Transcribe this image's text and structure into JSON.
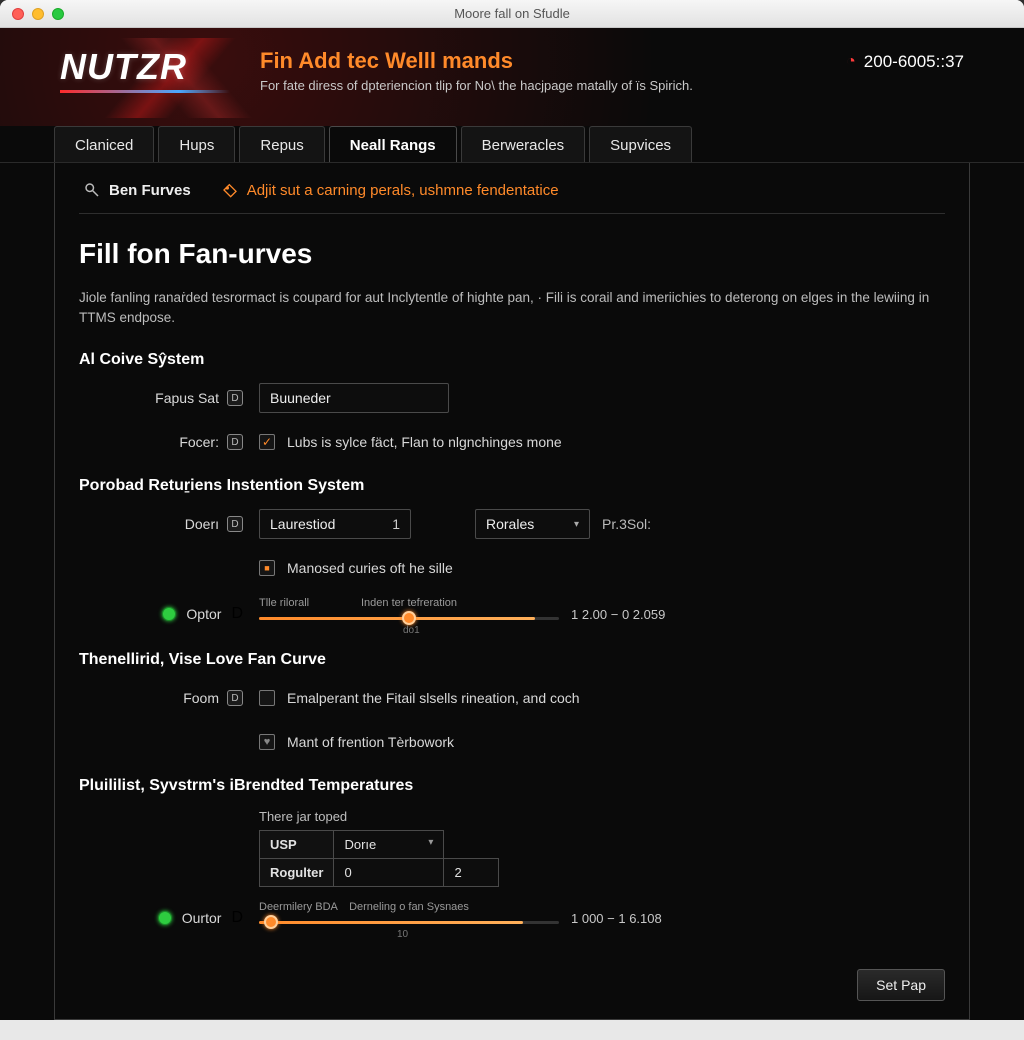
{
  "window": {
    "title": "Moore fall on Sfudle"
  },
  "header": {
    "logo": "NUTZR",
    "title": "Fin Add tec Welll mands",
    "subtitle": "For fate diress of dpteriencion tlip for No\\ the hacjpage matally of ïs Spirich.",
    "clock": "200-6005::37"
  },
  "tabs": [
    {
      "label": "Claniced",
      "active": false
    },
    {
      "label": "Hups",
      "active": false
    },
    {
      "label": "Repus",
      "active": false
    },
    {
      "label": "Neall Rangs",
      "active": true
    },
    {
      "label": "Berweracles",
      "active": false
    },
    {
      "label": "Supvices",
      "active": false
    }
  ],
  "subnav": {
    "a": "Ben Furves",
    "b": "Adjit sut a carning perals, ushmne fendentatice"
  },
  "page": {
    "title": "Fill fon Fan-urves",
    "lead": "Jiole fanling ranaṙded tesrormact is coupard for aut Inclytentle of highte pan,  · Fili is corail and imeriichies to deterong on elges in the lewiing in TTMS endpose."
  },
  "sec1": {
    "heading": "Al Coive Sŷstem",
    "row1_label": "Fapus Sat",
    "row1_value": "Buuneder",
    "row2_label": "Focer:",
    "row2_text": "Lubs is sylce fäct, Flan to nlgnchinges mone"
  },
  "sec2": {
    "heading": "Porobad Retuṟiens Instention System",
    "row1_label": "Doerı",
    "sel1_value": "Laurestiod",
    "sel1_num": "1",
    "sel2_value": "Rorales",
    "sel2_suffix": "Pr.3Sol:",
    "row2_text": "Manosed curies oft he sille",
    "status_label": "Optor",
    "slider": {
      "cap_l": "Tlle rilorall",
      "cap_r": "Inden ter tefreration",
      "sub": "do1",
      "pos": 50,
      "fill": 92
    },
    "readout": "1 2.00  −  0 2.059"
  },
  "sec3": {
    "heading": "Thenellirid, Vise Love Fan Curve",
    "row1_label": "Foom",
    "row1_text": "Emalperant the Fitail slsells rineation, and coch",
    "row2_text": "Mant of frention Tèrbowork"
  },
  "sec4": {
    "heading": "Pluililist, Syvstrm's iBrendted Temperatures",
    "caption": "There jar toped",
    "table": {
      "r1c1": "USP",
      "r1c2": "Dorıe",
      "r2c1": "Rogulter",
      "r2c2": "0",
      "r2c3": "2"
    },
    "status_label": "Ourtor",
    "slider": {
      "cap_l": "Deermilery BDA",
      "cap_r": "Derneling o fan Sysnaes",
      "sub": "10",
      "pos": 4,
      "fill": 88
    },
    "readout": "1 000  −  1 6.108"
  },
  "footer": {
    "button": "Set Pap"
  }
}
